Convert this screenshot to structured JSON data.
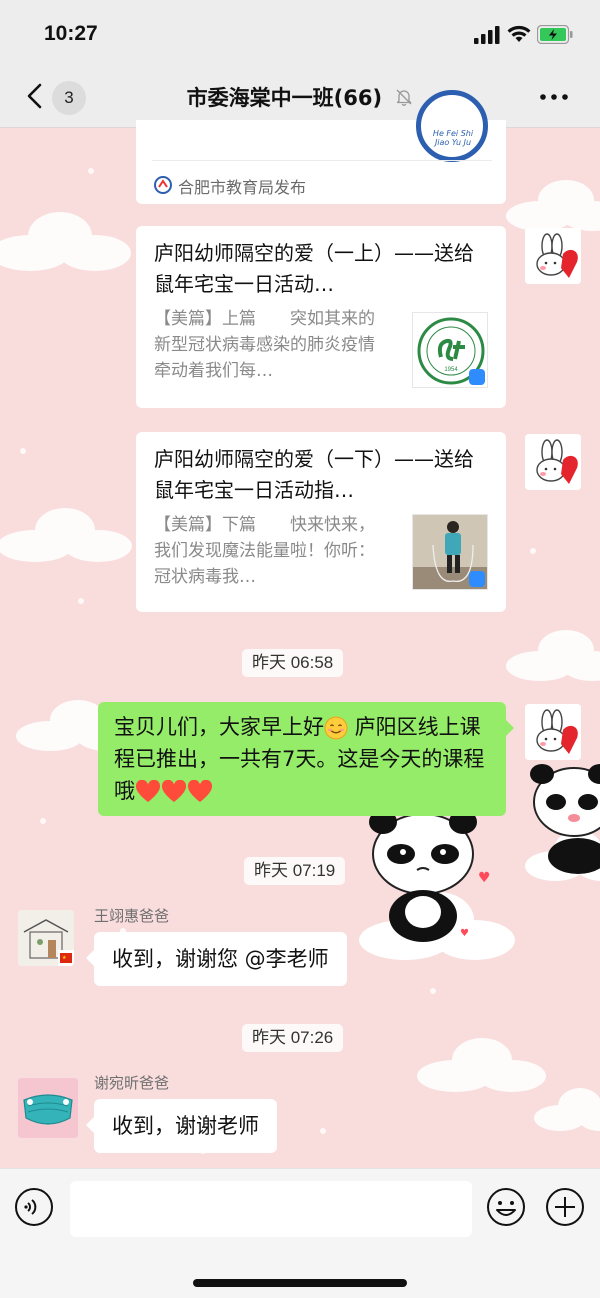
{
  "status_bar": {
    "time": "10:27"
  },
  "nav": {
    "unread_count": "3",
    "title": "市委海棠中一班(66)"
  },
  "messages": {
    "top_card": {
      "source": "合肥市教育局发布",
      "logo_text": "He Fei Shi Jiao Yu Ju"
    },
    "card1": {
      "title": "庐阳幼师隔空的爱（一上）——送给鼠年宅宝一日活动…",
      "desc": "【美篇】上篇　　突如其来的新型冠状病毒感染的肺炎疫情牵动着我们每…"
    },
    "card2": {
      "title": "庐阳幼师隔空的爱（一下）——送给鼠年宅宝一日活动指…",
      "desc": "【美篇】下篇　　快来快来，我们发现魔法能量啦！你听：冠状病毒我…"
    },
    "time1": "昨天 06:58",
    "green_bubble": {
      "part1": "宝贝儿们，大家早上好",
      "part2": " 庐阳区线上课程已推出，一共有7天。这是今天的课程哦"
    },
    "time2": "昨天 07:19",
    "msg1": {
      "sender": "王翊惠爸爸",
      "text": "收到，谢谢您 @李老师"
    },
    "time3": "昨天 07:26",
    "msg2": {
      "sender": "谢宛昕爸爸",
      "text": "收到，谢谢老师"
    }
  },
  "input_bar": {
    "placeholder": ""
  },
  "colors": {
    "chat_background": "#f9dcdc",
    "green_bubble": "#95ec69",
    "heart": "#ff3b3b"
  }
}
